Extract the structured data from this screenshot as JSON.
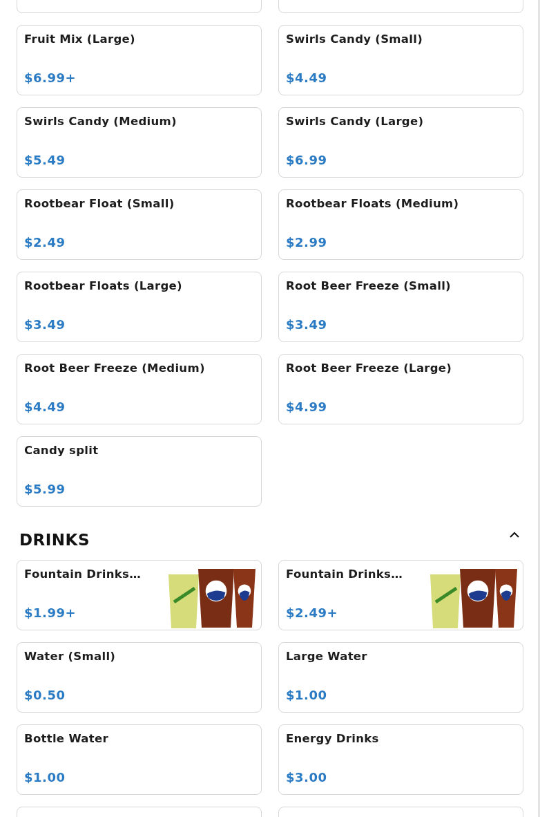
{
  "sections": [
    {
      "items": [
        {
          "name": "Fruit Mix (Large)",
          "price": "$6.99+",
          "kind": "plain"
        },
        {
          "name": "Swirls Candy (Small)",
          "price": "$4.49",
          "kind": "plain"
        },
        {
          "name": "Swirls Candy (Medium)",
          "price": "$5.49",
          "kind": "plain"
        },
        {
          "name": "Swirls Candy (Large)",
          "price": "$6.99",
          "kind": "plain"
        },
        {
          "name": "Rootbear Float (Small)",
          "price": "$2.49",
          "kind": "plain"
        },
        {
          "name": "Rootbear Floats (Medium)",
          "price": "$2.99",
          "kind": "plain"
        },
        {
          "name": "Rootbear Floats (Large)",
          "price": "$3.49",
          "kind": "plain"
        },
        {
          "name": "Root Beer Freeze (Small)",
          "price": "$3.49",
          "kind": "plain"
        },
        {
          "name": "Root Beer Freeze (Medium)",
          "price": "$4.49",
          "kind": "plain"
        },
        {
          "name": "Root Beer Freeze (Large)",
          "price": "$4.99",
          "kind": "plain"
        },
        {
          "name": "Candy split",
          "price": "$5.99",
          "kind": "plain"
        }
      ]
    },
    {
      "title": "DRINKS",
      "expanded": true,
      "items": [
        {
          "name": "Fountain Drinks…",
          "price": "$1.99+",
          "kind": "photo"
        },
        {
          "name": "Fountain Drinks…",
          "price": "$2.49+",
          "kind": "photo"
        },
        {
          "name": "Water (Small)",
          "price": "$0.50",
          "kind": "plain"
        },
        {
          "name": "Large Water",
          "price": "$1.00",
          "kind": "plain"
        },
        {
          "name": "Bottle Water",
          "price": "$1.00",
          "kind": "plain"
        },
        {
          "name": "Energy Drinks",
          "price": "$3.00",
          "kind": "plain"
        }
      ]
    }
  ]
}
